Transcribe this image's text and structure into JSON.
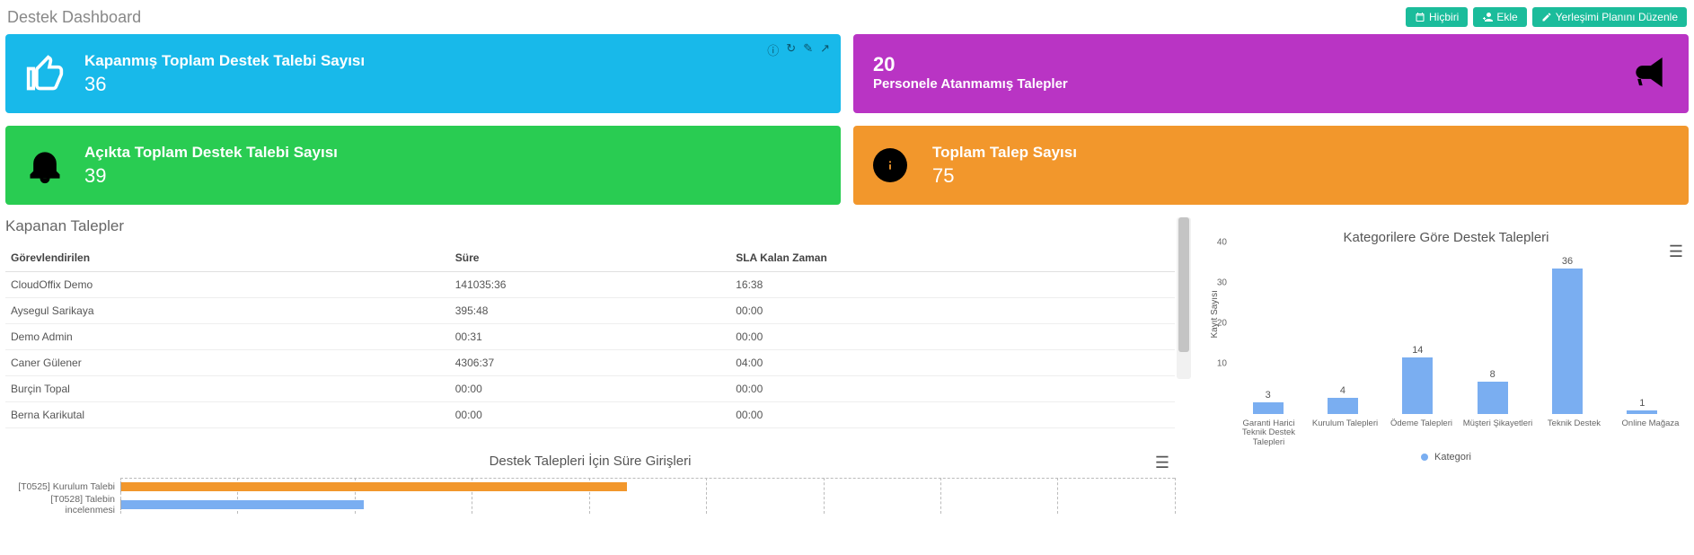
{
  "header": {
    "title": "Destek Dashboard",
    "buttons": {
      "none": "Hiçbiri",
      "add": "Ekle",
      "edit_layout": "Yerleşimi Planını Düzenle"
    }
  },
  "tiles": {
    "closed": {
      "title": "Kapanmış Toplam Destek Talebi Sayısı",
      "value": "36"
    },
    "unassigned": {
      "value": "20",
      "title": "Personele Atanmamış Talepler"
    },
    "open": {
      "title": "Açıkta Toplam Destek Talebi Sayısı",
      "value": "39"
    },
    "total": {
      "title": "Toplam Talep Sayısı",
      "value": "75"
    }
  },
  "table": {
    "title": "Kapanan Talepler",
    "headers": {
      "assignee": "Görevlendirilen",
      "duration": "Süre",
      "sla": "SLA Kalan Zaman"
    },
    "rows": [
      {
        "assignee": "CloudOffix Demo",
        "duration": "141035:36",
        "sla": "16:38"
      },
      {
        "assignee": "Aysegul Sarikaya",
        "duration": "395:48",
        "sla": "00:00"
      },
      {
        "assignee": "Demo Admin",
        "duration": "00:31",
        "sla": "00:00"
      },
      {
        "assignee": "Caner Gülener",
        "duration": "4306:37",
        "sla": "04:00"
      },
      {
        "assignee": "Burçin Topal",
        "duration": "00:00",
        "sla": "00:00"
      },
      {
        "assignee": "Berna Karikutal",
        "duration": "00:00",
        "sla": "00:00"
      }
    ]
  },
  "chart_gantt": {
    "title": "Destek Talepleri İçin Süre Girişleri",
    "rows": [
      {
        "label": "[T0525] Kurulum Talebi",
        "width_pct": 48,
        "color": "#f2972c"
      },
      {
        "label": "[T0528] Talebin incelenmesi",
        "width_pct": 23,
        "color": "#7aaef1"
      }
    ]
  },
  "chart_data": {
    "type": "bar",
    "title": "Kategorilere Göre Destek Talepleri",
    "ylabel": "Kayıt Sayısı",
    "ylim": [
      0,
      40
    ],
    "yticks": [
      10,
      20,
      30,
      40
    ],
    "categories": [
      "Garanti Harici Teknik Destek Talepleri",
      "Kurulum Talepleri",
      "Ödeme Talepleri",
      "Müşteri Şikayetleri",
      "Teknik Destek",
      "Online Mağaza"
    ],
    "values": [
      3,
      4,
      14,
      8,
      36,
      1
    ],
    "legend": "Kategori"
  }
}
